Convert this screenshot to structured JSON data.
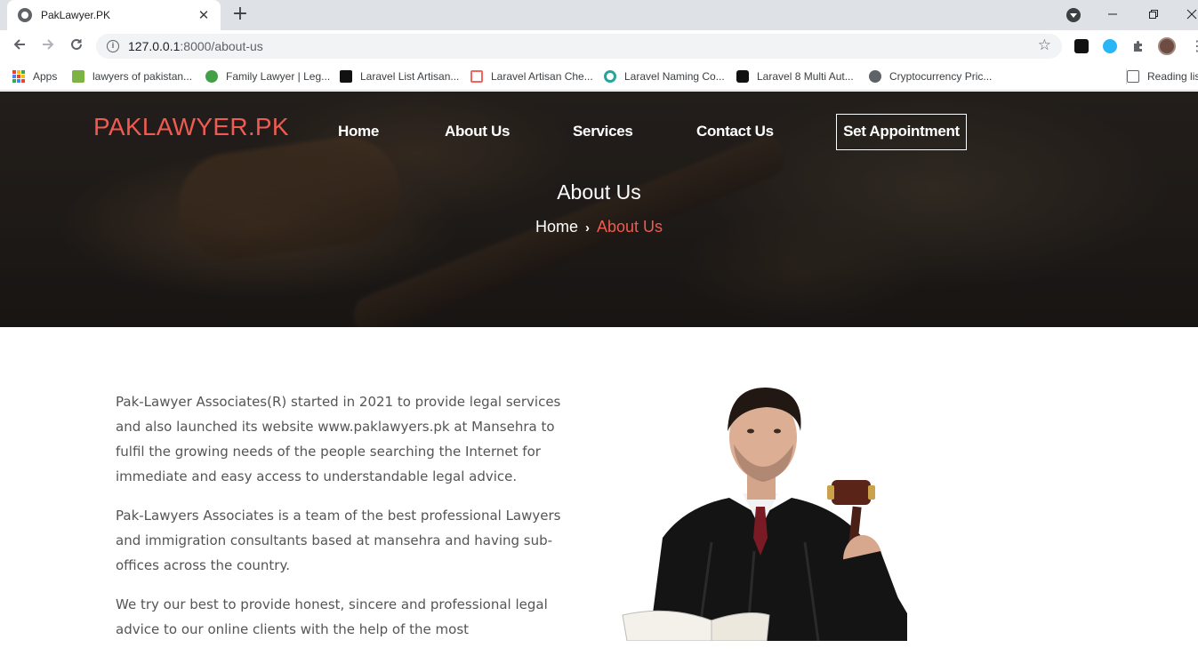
{
  "browser": {
    "tab_title": "PakLawyer.PK",
    "url_host": "127.0.0.1",
    "url_path": ":8000/about-us",
    "bookmarks": [
      {
        "label": "Apps"
      },
      {
        "label": "lawyers of pakistan..."
      },
      {
        "label": "Family Lawyer | Leg..."
      },
      {
        "label": "Laravel List Artisan..."
      },
      {
        "label": "Laravel Artisan Che..."
      },
      {
        "label": "Laravel Naming Co..."
      },
      {
        "label": "Laravel 8 Multi Aut..."
      },
      {
        "label": "Cryptocurrency Pric..."
      }
    ],
    "reading_list": "Reading lis",
    "icons": {
      "info": "i",
      "star": "☆",
      "close": "✕",
      "new_tab": "+"
    }
  },
  "site": {
    "logo": "PAKLAWYER.PK",
    "nav": [
      "Home",
      "About Us",
      "Services",
      "Contact Us"
    ],
    "cta": "Set Appointment",
    "accent": "#f05a50",
    "hero": {
      "title": "About Us",
      "breadcrumb_home": "Home",
      "breadcrumb_current": "About Us"
    },
    "paragraphs": [
      "Pak-Lawyer Associates(R) started in 2021 to provide legal services and also launched its website www.paklawyers.pk at Mansehra to fulfil the growing needs of the people searching the Internet for immediate and easy access to understandable legal advice.",
      "Pak-Lawyers Associates is a team of the best professional Lawyers and immigration consultants based at mansehra and having sub-offices across the country.",
      "We try our best to provide honest, sincere and professional legal advice to our online clients with the help of the most"
    ]
  }
}
